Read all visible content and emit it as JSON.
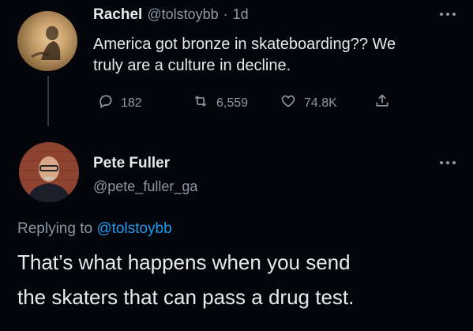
{
  "reply_tweet": {
    "author_name": "Rachel",
    "author_handle": "@tolstoybb",
    "separator": "·",
    "time": "1d",
    "text_line1": "America got bronze in skateboarding?? We",
    "text_line2": "truly are a culture in decline.",
    "stats": {
      "replies": "182",
      "retweets": "6,559",
      "likes": "74.8K"
    },
    "more_icon": "more-horizontal-icon"
  },
  "main_tweet": {
    "author_name": "Pete Fuller",
    "author_handle": "@pete_fuller_ga",
    "replying_prefix": "Replying to",
    "replying_handle": "@tolstoybb",
    "text_line1": "That’s what happens when you send",
    "text_line2": "the skaters that can pass a drug test.",
    "more_icon": "more-horizontal-icon"
  },
  "colors": {
    "background": "#04050a",
    "text": "#e7e9ea",
    "muted": "#8b98a5",
    "link": "#1d9bf0"
  }
}
